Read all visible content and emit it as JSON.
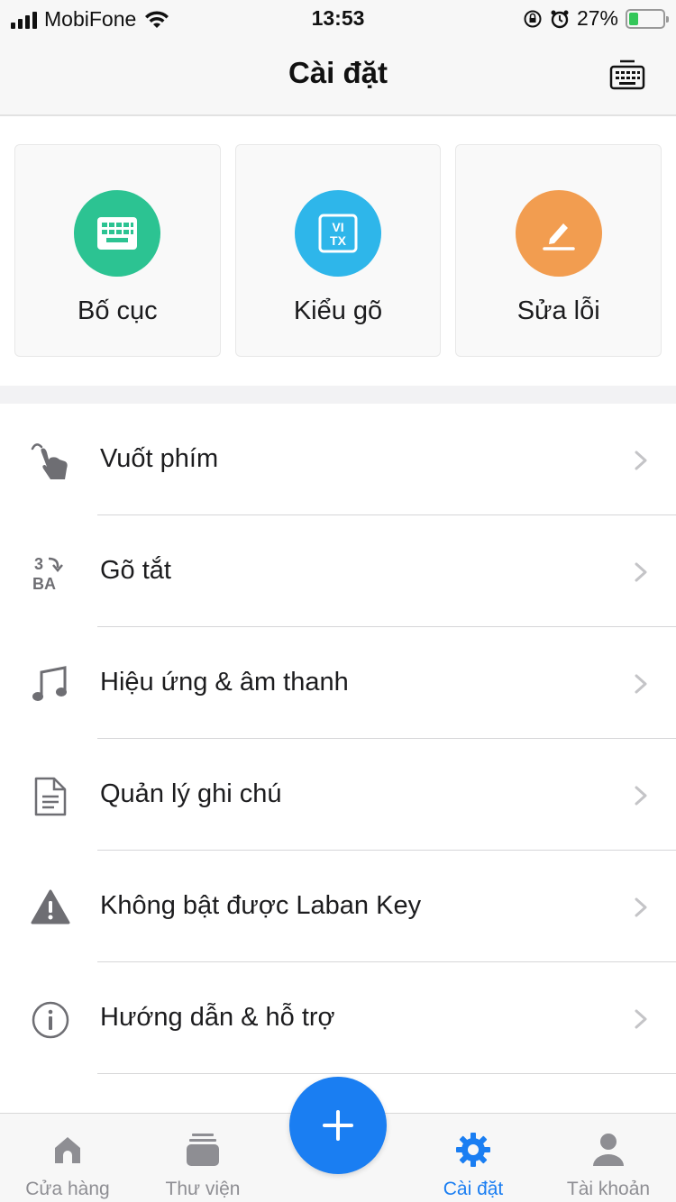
{
  "status_bar": {
    "carrier": "MobiFone",
    "time": "13:53",
    "battery": "27%",
    "battery_level": 0.27
  },
  "header": {
    "title": "Cài đặt",
    "action_icon": "keyboard-icon"
  },
  "tiles": [
    {
      "label": "Bố cục",
      "icon": "keyboard-icon",
      "color": "#2cc392"
    },
    {
      "label": "Kiểu gõ",
      "icon": "vitx-icon",
      "icon_text_top": "VI",
      "icon_text_bottom": "TX",
      "color": "#2eb6ea"
    },
    {
      "label": "Sửa lỗi",
      "icon": "pencil-icon",
      "color": "#f29d50"
    }
  ],
  "settings": [
    {
      "label": "Vuốt phím",
      "icon": "swipe-hand-icon"
    },
    {
      "label": "Gõ tắt",
      "icon": "shortcut-icon",
      "icon_text_top": "3",
      "icon_text_bottom": "BA"
    },
    {
      "label": "Hiệu ứng & âm thanh",
      "icon": "music-note-icon"
    },
    {
      "label": "Quản lý ghi chú",
      "icon": "note-document-icon"
    },
    {
      "label": "Không bật được Laban Key",
      "icon": "warning-icon"
    },
    {
      "label": "Hướng dẫn & hỗ trợ",
      "icon": "info-icon"
    }
  ],
  "tab_bar": {
    "tabs": [
      {
        "label": "Cửa hàng",
        "icon": "store-icon",
        "active": false
      },
      {
        "label": "Thư viện",
        "icon": "library-icon",
        "active": false
      },
      {
        "label": "Cài đặt",
        "icon": "gear-icon",
        "active": true
      },
      {
        "label": "Tài khoản",
        "icon": "account-icon",
        "active": false
      }
    ],
    "fab_icon": "plus-icon"
  },
  "colors": {
    "accent": "#1a7ef2",
    "inactive": "#8e8e93"
  }
}
